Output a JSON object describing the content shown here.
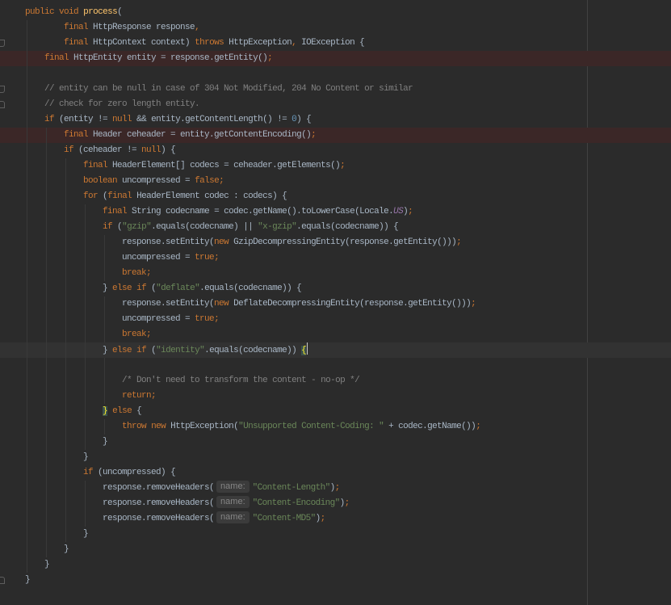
{
  "editor": {
    "colors": {
      "background": "#2b2b2b",
      "plain": "#a9b7c6",
      "keyword": "#cc7832",
      "method_declaration": "#ffc66d",
      "string": "#6a8759",
      "comment": "#808080",
      "number": "#6897bb",
      "static_field": "#9876aa",
      "hint_text": "#858585",
      "hint_bg": "#3b3b3b",
      "brace_match_bg": "#3b514d",
      "brace_match_fg": "#ffef28",
      "current_line": "#323232",
      "marked_line": "#3b2727"
    },
    "lines": [
      {
        "tokens": [
          {
            "p": "    "
          },
          {
            "k": "public"
          },
          {
            "p": " "
          },
          {
            "k": "void"
          },
          {
            "p": " "
          },
          {
            "f": "process"
          },
          {
            "p": "("
          }
        ]
      },
      {
        "tokens": [
          {
            "p": "            "
          },
          {
            "k": "final"
          },
          {
            "p": " HttpResponse response"
          },
          {
            "k": ","
          }
        ]
      },
      {
        "tokens": [
          {
            "p": "            "
          },
          {
            "k": "final"
          },
          {
            "p": " HttpContext context) "
          },
          {
            "k": "throws"
          },
          {
            "p": " HttpException"
          },
          {
            "k": ","
          },
          {
            "p": " IOException {"
          }
        ]
      },
      {
        "marked": true,
        "tokens": [
          {
            "p": "        "
          },
          {
            "k": "final"
          },
          {
            "p": " HttpEntity entity = response.getEntity()"
          },
          {
            "k": ";"
          }
        ]
      },
      {
        "tokens": []
      },
      {
        "tokens": [
          {
            "p": "        "
          },
          {
            "c": "// entity can be null in case of 304 Not Modified, 204 No Content or similar"
          }
        ]
      },
      {
        "tokens": [
          {
            "p": "        "
          },
          {
            "c": "// check for zero length entity."
          }
        ]
      },
      {
        "tokens": [
          {
            "p": "        "
          },
          {
            "k": "if"
          },
          {
            "p": " (entity != "
          },
          {
            "k": "null"
          },
          {
            "p": " && entity.getContentLength() != "
          },
          {
            "n": "0"
          },
          {
            "p": ") {"
          }
        ]
      },
      {
        "marked": true,
        "tokens": [
          {
            "p": "            "
          },
          {
            "k": "final"
          },
          {
            "p": " Header ceheader = entity.getContentEncoding()"
          },
          {
            "k": ";"
          }
        ]
      },
      {
        "tokens": [
          {
            "p": "            "
          },
          {
            "k": "if"
          },
          {
            "p": " (ceheader != "
          },
          {
            "k": "null"
          },
          {
            "p": ") {"
          }
        ]
      },
      {
        "tokens": [
          {
            "p": "                "
          },
          {
            "k": "final"
          },
          {
            "p": " HeaderElement[] codecs = ceheader.getElements()"
          },
          {
            "k": ";"
          }
        ]
      },
      {
        "tokens": [
          {
            "p": "                "
          },
          {
            "k": "boolean"
          },
          {
            "p": " uncompressed = "
          },
          {
            "k": "false"
          },
          {
            "k": ";"
          }
        ]
      },
      {
        "tokens": [
          {
            "p": "                "
          },
          {
            "k": "for"
          },
          {
            "p": " ("
          },
          {
            "k": "final"
          },
          {
            "p": " HeaderElement codec : codecs) {"
          }
        ]
      },
      {
        "tokens": [
          {
            "p": "                    "
          },
          {
            "k": "final"
          },
          {
            "p": " String codecname = codec.getName().toLowerCase(Locale."
          },
          {
            "i": "US"
          },
          {
            "p": ")"
          },
          {
            "k": ";"
          }
        ]
      },
      {
        "tokens": [
          {
            "p": "                    "
          },
          {
            "k": "if"
          },
          {
            "p": " ("
          },
          {
            "s": "\"gzip\""
          },
          {
            "p": ".equals(codecname) || "
          },
          {
            "s": "\"x-gzip\""
          },
          {
            "p": ".equals(codecname)) {"
          }
        ]
      },
      {
        "tokens": [
          {
            "p": "                        response.setEntity("
          },
          {
            "k": "new"
          },
          {
            "p": " GzipDecompressingEntity(response.getEntity()))"
          },
          {
            "k": ";"
          }
        ]
      },
      {
        "tokens": [
          {
            "p": "                        uncompressed = "
          },
          {
            "k": "true"
          },
          {
            "k": ";"
          }
        ]
      },
      {
        "tokens": [
          {
            "p": "                        "
          },
          {
            "k": "break"
          },
          {
            "k": ";"
          }
        ]
      },
      {
        "tokens": [
          {
            "p": "                    } "
          },
          {
            "k": "else"
          },
          {
            "p": " "
          },
          {
            "k": "if"
          },
          {
            "p": " ("
          },
          {
            "s": "\"deflate\""
          },
          {
            "p": ".equals(codecname)) {"
          }
        ]
      },
      {
        "tokens": [
          {
            "p": "                        response.setEntity("
          },
          {
            "k": "new"
          },
          {
            "p": " DeflateDecompressingEntity(response.getEntity()))"
          },
          {
            "k": ";"
          }
        ]
      },
      {
        "tokens": [
          {
            "p": "                        uncompressed = "
          },
          {
            "k": "true"
          },
          {
            "k": ";"
          }
        ]
      },
      {
        "tokens": [
          {
            "p": "                        "
          },
          {
            "k": "break"
          },
          {
            "k": ";"
          }
        ]
      },
      {
        "current": true,
        "caret_at_end": true,
        "tokens": [
          {
            "p": "                    } "
          },
          {
            "k": "else"
          },
          {
            "p": " "
          },
          {
            "k": "if"
          },
          {
            "p": " ("
          },
          {
            "s": "\"identity\""
          },
          {
            "p": ".equals(codecname)) "
          },
          {
            "b": "{"
          }
        ]
      },
      {
        "tokens": []
      },
      {
        "tokens": [
          {
            "p": "                        "
          },
          {
            "c": "/* Don't need to transform the content - no-op */"
          }
        ]
      },
      {
        "tokens": [
          {
            "p": "                        "
          },
          {
            "k": "return"
          },
          {
            "k": ";"
          }
        ]
      },
      {
        "tokens": [
          {
            "p": "                    "
          },
          {
            "b": "}"
          },
          {
            "p": " "
          },
          {
            "k": "else"
          },
          {
            "p": " {"
          }
        ]
      },
      {
        "tokens": [
          {
            "p": "                        "
          },
          {
            "k": "throw"
          },
          {
            "p": " "
          },
          {
            "k": "new"
          },
          {
            "p": " HttpException("
          },
          {
            "s": "\"Unsupported Content-Coding: \""
          },
          {
            "p": " + codec.getName())"
          },
          {
            "k": ";"
          }
        ]
      },
      {
        "tokens": [
          {
            "p": "                    }"
          }
        ]
      },
      {
        "tokens": [
          {
            "p": "                }"
          }
        ]
      },
      {
        "tokens": [
          {
            "p": "                "
          },
          {
            "k": "if"
          },
          {
            "p": " (uncompressed) {"
          }
        ]
      },
      {
        "tokens": [
          {
            "p": "                    response.removeHeaders("
          },
          {
            "h": "name:"
          },
          {
            "s": "\"Content-Length\""
          },
          {
            "p": ")"
          },
          {
            "k": ";"
          }
        ]
      },
      {
        "tokens": [
          {
            "p": "                    response.removeHeaders("
          },
          {
            "h": "name:"
          },
          {
            "s": "\"Content-Encoding\""
          },
          {
            "p": ")"
          },
          {
            "k": ";"
          }
        ]
      },
      {
        "tokens": [
          {
            "p": "                    response.removeHeaders("
          },
          {
            "h": "name:"
          },
          {
            "s": "\"Content-MD5\""
          },
          {
            "p": ")"
          },
          {
            "k": ";"
          }
        ]
      },
      {
        "tokens": [
          {
            "p": "                }"
          }
        ]
      },
      {
        "tokens": [
          {
            "p": "            }"
          }
        ]
      },
      {
        "tokens": [
          {
            "p": "        }"
          }
        ]
      },
      {
        "tokens": [
          {
            "p": "    }"
          }
        ]
      }
    ]
  }
}
